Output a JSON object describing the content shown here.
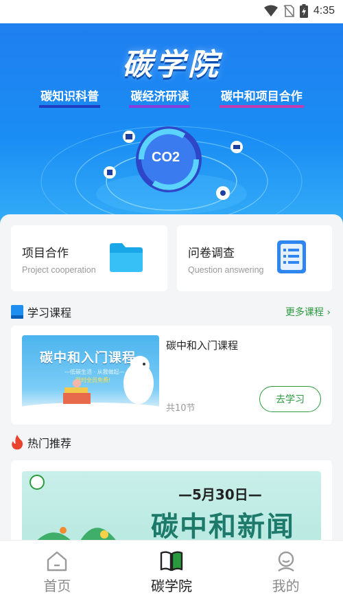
{
  "status_bar": {
    "time": "4:35",
    "icons": [
      "wifi-icon",
      "no-sim-icon",
      "battery-charging-icon"
    ]
  },
  "hero": {
    "title": "碳学院",
    "tags": [
      "碳知识科普",
      "碳经济研读",
      "碳中和项目合作"
    ],
    "badge_text": "CO2"
  },
  "quick_cards": [
    {
      "name": "项目合作",
      "subtitle": "Project cooperation",
      "icon": "folder-icon"
    },
    {
      "name": "问卷调查",
      "subtitle": "Question answering",
      "icon": "questionnaire-list-icon"
    }
  ],
  "courses_section": {
    "title": "学习课程",
    "more_label": "更多课程",
    "course": {
      "name": "碳中和入门课程",
      "count": "共10节",
      "button": "去学习",
      "image_title": "碳中和入门课程",
      "image_sub1": "—低碳生活 · 从我做起—",
      "image_sub2": "限时全员免费!"
    }
  },
  "hot_section": {
    "title": "热门推荐",
    "banner_date": "—5月30日—",
    "banner_title": "碳中和新闻"
  },
  "tabbar": {
    "tabs": [
      {
        "label": "首页",
        "icon": "home-icon",
        "active": false
      },
      {
        "label": "碳学院",
        "icon": "book-icon",
        "active": true
      },
      {
        "label": "我的",
        "icon": "profile-icon",
        "active": false
      }
    ]
  },
  "colors": {
    "accent_green": "#2b9a3e",
    "hero_blue": "#1f7ff0"
  }
}
